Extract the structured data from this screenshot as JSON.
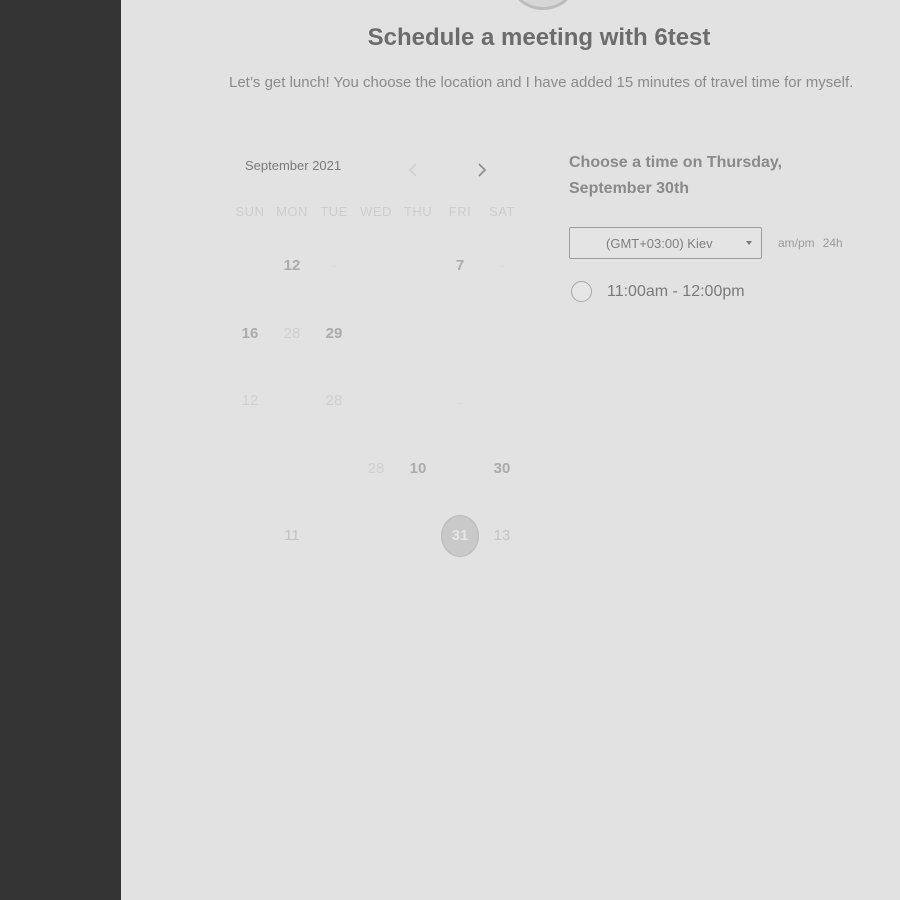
{
  "header": {
    "title": "Schedule a meeting with 6test",
    "description": "Let’s get lunch! You choose the location and I have added 15 minutes of travel time for myself."
  },
  "calendar": {
    "month_label": "September 2021",
    "weekdays": [
      "SUN",
      "MON",
      "TUE",
      "WED",
      "THU",
      "FRI",
      "SAT"
    ],
    "cells": [
      {
        "text": "",
        "style": "empty"
      },
      {
        "text": "12",
        "style": "bold"
      },
      {
        "text": "-",
        "style": "tiny"
      },
      {
        "text": "",
        "style": "empty"
      },
      {
        "text": "",
        "style": "empty"
      },
      {
        "text": "7",
        "style": "bold"
      },
      {
        "text": "-",
        "style": "tiny"
      },
      {
        "text": "16",
        "style": "bold"
      },
      {
        "text": "28",
        "style": "faint"
      },
      {
        "text": "29",
        "style": "bold"
      },
      {
        "text": "",
        "style": "empty"
      },
      {
        "text": "",
        "style": "empty"
      },
      {
        "text": "",
        "style": "empty"
      },
      {
        "text": "",
        "style": "empty"
      },
      {
        "text": "12",
        "style": "faint"
      },
      {
        "text": "",
        "style": "empty"
      },
      {
        "text": "28",
        "style": "faint"
      },
      {
        "text": "",
        "style": "empty"
      },
      {
        "text": "",
        "style": "empty"
      },
      {
        "text": "..",
        "style": "tiny"
      },
      {
        "text": "",
        "style": "empty"
      },
      {
        "text": "",
        "style": "empty"
      },
      {
        "text": "",
        "style": "empty"
      },
      {
        "text": "",
        "style": "empty"
      },
      {
        "text": "28",
        "style": "faint"
      },
      {
        "text": "10",
        "style": "bold"
      },
      {
        "text": "",
        "style": "empty"
      },
      {
        "text": "30",
        "style": "bold"
      },
      {
        "text": "",
        "style": "empty"
      },
      {
        "text": "11",
        "style": "muted"
      },
      {
        "text": "",
        "style": "empty"
      },
      {
        "text": "",
        "style": "empty"
      },
      {
        "text": "",
        "style": "empty"
      },
      {
        "text": "31",
        "style": "selected"
      },
      {
        "text": "13",
        "style": "muted"
      }
    ]
  },
  "times": {
    "heading": "Choose a time on Thursday, September 30th",
    "timezone_value": "(GMT+03:00) Kiev",
    "format_ampm": "am/pm",
    "format_24h": "24h",
    "slots": [
      {
        "label": "11:00am - 12:00pm"
      }
    ]
  }
}
